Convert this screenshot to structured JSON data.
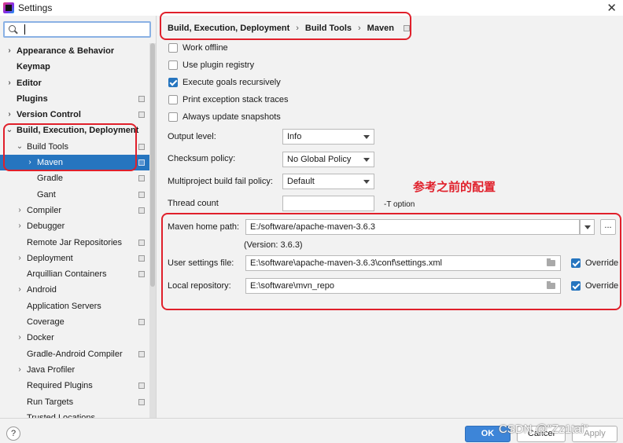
{
  "window": {
    "title": "Settings"
  },
  "search": {
    "value": ""
  },
  "sidebar": {
    "items": [
      {
        "label": "Appearance & Behavior",
        "bold": true,
        "arrow": "›",
        "indent": 0,
        "proj": false,
        "selected": false
      },
      {
        "label": "Keymap",
        "bold": true,
        "arrow": "",
        "indent": 0,
        "proj": false,
        "selected": false
      },
      {
        "label": "Editor",
        "bold": true,
        "arrow": "›",
        "indent": 0,
        "proj": false,
        "selected": false
      },
      {
        "label": "Plugins",
        "bold": true,
        "arrow": "",
        "indent": 0,
        "proj": true,
        "selected": false
      },
      {
        "label": "Version Control",
        "bold": true,
        "arrow": "›",
        "indent": 0,
        "proj": true,
        "selected": false
      },
      {
        "label": "Build, Execution, Deployment",
        "bold": true,
        "arrow": "⌄",
        "indent": 0,
        "proj": false,
        "selected": false
      },
      {
        "label": "Build Tools",
        "bold": false,
        "arrow": "⌄",
        "indent": 1,
        "proj": true,
        "selected": false
      },
      {
        "label": "Maven",
        "bold": false,
        "arrow": "›",
        "indent": 2,
        "proj": true,
        "selected": true
      },
      {
        "label": "Gradle",
        "bold": false,
        "arrow": "",
        "indent": 2,
        "proj": true,
        "selected": false
      },
      {
        "label": "Gant",
        "bold": false,
        "arrow": "",
        "indent": 2,
        "proj": true,
        "selected": false
      },
      {
        "label": "Compiler",
        "bold": false,
        "arrow": "›",
        "indent": 1,
        "proj": true,
        "selected": false
      },
      {
        "label": "Debugger",
        "bold": false,
        "arrow": "›",
        "indent": 1,
        "proj": false,
        "selected": false
      },
      {
        "label": "Remote Jar Repositories",
        "bold": false,
        "arrow": "",
        "indent": 1,
        "proj": true,
        "selected": false
      },
      {
        "label": "Deployment",
        "bold": false,
        "arrow": "›",
        "indent": 1,
        "proj": true,
        "selected": false
      },
      {
        "label": "Arquillian Containers",
        "bold": false,
        "arrow": "",
        "indent": 1,
        "proj": true,
        "selected": false
      },
      {
        "label": "Android",
        "bold": false,
        "arrow": "›",
        "indent": 1,
        "proj": false,
        "selected": false
      },
      {
        "label": "Application Servers",
        "bold": false,
        "arrow": "",
        "indent": 1,
        "proj": false,
        "selected": false
      },
      {
        "label": "Coverage",
        "bold": false,
        "arrow": "",
        "indent": 1,
        "proj": true,
        "selected": false
      },
      {
        "label": "Docker",
        "bold": false,
        "arrow": "›",
        "indent": 1,
        "proj": false,
        "selected": false
      },
      {
        "label": "Gradle-Android Compiler",
        "bold": false,
        "arrow": "",
        "indent": 1,
        "proj": true,
        "selected": false
      },
      {
        "label": "Java Profiler",
        "bold": false,
        "arrow": "›",
        "indent": 1,
        "proj": false,
        "selected": false
      },
      {
        "label": "Required Plugins",
        "bold": false,
        "arrow": "",
        "indent": 1,
        "proj": true,
        "selected": false
      },
      {
        "label": "Run Targets",
        "bold": false,
        "arrow": "",
        "indent": 1,
        "proj": true,
        "selected": false
      },
      {
        "label": "Trusted Locations",
        "bold": false,
        "arrow": "",
        "indent": 1,
        "proj": false,
        "selected": false
      }
    ]
  },
  "breadcrumb": {
    "parts": [
      "Build, Execution, Deployment",
      "Build Tools",
      "Maven"
    ]
  },
  "options": [
    {
      "label": "Work offline",
      "checked": false
    },
    {
      "label": "Use plugin registry",
      "checked": false
    },
    {
      "label": "Execute goals recursively",
      "checked": true
    },
    {
      "label": "Print exception stack traces",
      "checked": false
    },
    {
      "label": "Always update snapshots",
      "checked": false
    }
  ],
  "fields": {
    "output_level": {
      "label": "Output level:",
      "value": "Info"
    },
    "checksum_policy": {
      "label": "Checksum policy:",
      "value": "No Global Policy"
    },
    "fail_policy": {
      "label": "Multiproject build fail policy:",
      "value": "Default"
    },
    "thread_count": {
      "label": "Thread count",
      "value": "",
      "hint": "-T option"
    },
    "maven_home": {
      "label": "Maven home path:",
      "value": "E:/software/apache-maven-3.6.3",
      "browse": "...",
      "version": "(Version: 3.6.3)"
    },
    "user_settings": {
      "label": "User settings file:",
      "value": "E:\\software\\apache-maven-3.6.3\\conf\\settings.xml",
      "override_label": "Override",
      "override": true
    },
    "local_repo": {
      "label": "Local repository:",
      "value": "E:\\software\\mvn_repo",
      "override_label": "Override",
      "override": true
    }
  },
  "annotation": {
    "text": "参考之前的配置",
    "color": "#e0202b"
  },
  "footer": {
    "help": "?",
    "ok": "OK",
    "cancel": "Cancel",
    "apply": "Apply"
  },
  "watermark": "CSDN @\"Zz1tai\"",
  "colors": {
    "accent": "#2675bf",
    "highlight": "#e0202b"
  }
}
